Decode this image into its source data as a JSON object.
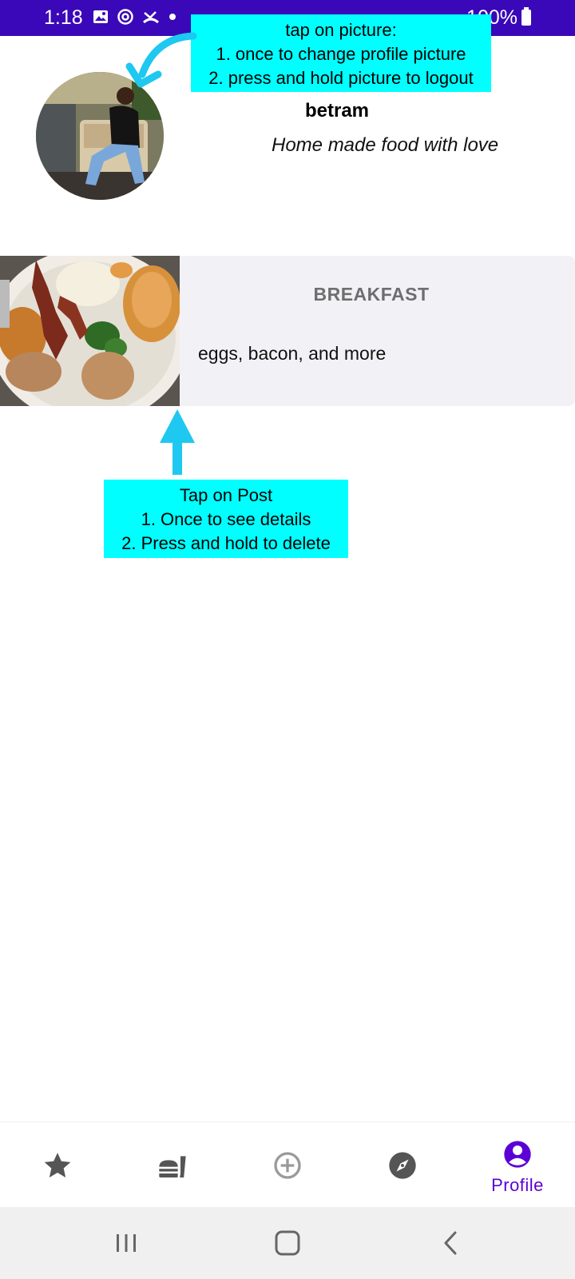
{
  "status_bar": {
    "time": "1:18",
    "battery_text": "100%",
    "background": "#3a08b8"
  },
  "tips": {
    "profile": {
      "line1": "tap on picture:",
      "line2": "1. once to change profile picture",
      "line3": "2. press and hold picture to logout"
    },
    "post": {
      "line1": "Tap on Post",
      "line2": "1. Once to see details",
      "line3": "2. Press and hold to delete"
    },
    "highlight_color": "#00ffff",
    "arrow_color": "#1ec8f0"
  },
  "profile": {
    "username": "betram",
    "tagline": "Home made food with love"
  },
  "posts": [
    {
      "title": "BREAKFAST",
      "description": "eggs, bacon, and more"
    }
  ],
  "bottom_nav": {
    "items": [
      {
        "icon": "star-icon",
        "label": ""
      },
      {
        "icon": "fastfood-icon",
        "label": ""
      },
      {
        "icon": "add-circle-icon",
        "label": ""
      },
      {
        "icon": "explore-icon",
        "label": ""
      },
      {
        "icon": "account-circle-icon",
        "label": "Profile"
      }
    ],
    "active_color": "#5a00d6",
    "inactive_color": "#555555"
  },
  "system_nav": {
    "buttons": [
      "recent-apps-icon",
      "home-icon",
      "back-icon"
    ]
  }
}
